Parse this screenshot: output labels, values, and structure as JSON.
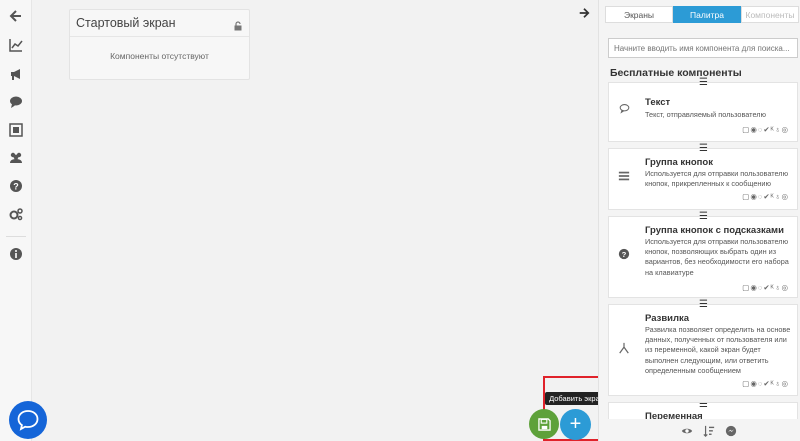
{
  "canvas": {
    "screen_card": {
      "title": "Стартовый экран",
      "empty_text": "Компоненты отсутствуют"
    },
    "tooltip": "Добавить экран",
    "add_symbol": "+"
  },
  "panel": {
    "tabs": [
      "Экраны",
      "Палитра",
      "Компоненты"
    ],
    "active_tab": "Палитра",
    "search_placeholder": "Начните вводить имя компонента для поиска...",
    "section_title": "Бесплатные компоненты",
    "components": [
      {
        "name": "Текст",
        "desc": "Текст, отправляемый пользователю",
        "icon": "chat-bubble-icon",
        "platforms": "▢◉◌✔ᴷ♁◎"
      },
      {
        "name": "Группа кнопок",
        "desc": "Используется для отправки пользователю кнопок, прикрепленных к сообщению",
        "icon": "list-icon",
        "platforms": "▢◉◌✔ᴷ♁◎"
      },
      {
        "name": "Группа кнопок с подсказками",
        "desc": "Используется для отправки пользователю кнопок, позволяющих выбрать один из вариантов, без необходимости его набора на клавиатуре",
        "icon": "question-circle-icon",
        "platforms": "▢◉◌✔ᴷ♁◎"
      },
      {
        "name": "Развилка",
        "desc": "Развилка позволяет определить на основе данных, полученных от пользователя или из переменной, какой экран будет выполнен следующим, или ответить определенным сообщением",
        "icon": "fork-icon",
        "platforms": "▢◉◌✔ᴷ♁◎"
      },
      {
        "name": "Переменная",
        "desc": "",
        "icon": "variable-icon",
        "platforms": ""
      }
    ]
  },
  "colors": {
    "accent": "#2c9bd6",
    "save": "#5ea13a",
    "chat": "#1565d8",
    "highlight": "#e0222a"
  }
}
